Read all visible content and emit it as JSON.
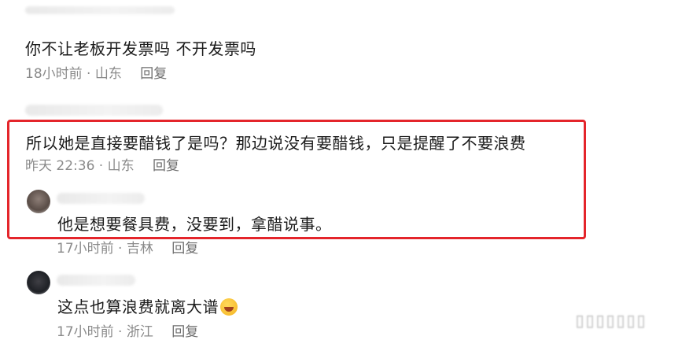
{
  "comments": [
    {
      "text": "你不让老板开发票吗   不开发票吗",
      "time": "18小时前 · 山东",
      "reply": "回复"
    },
    {
      "text": "所以她是直接要醋钱了是吗？那边说没有要醋钱，只是提醒了不要浪费",
      "time": "昨天 22:36 · 山东",
      "reply": "回复"
    },
    {
      "text": "他是想要餐具费，没要到，拿醋说事。",
      "time": "17小时前 · 吉林",
      "reply": "回复"
    },
    {
      "text": "这点也算浪费就离大谱",
      "emoji": "rolling-laughing-emoji",
      "time": "17小时前 · 浙江",
      "reply": "回复"
    }
  ],
  "highlight_color": "#e4252b"
}
